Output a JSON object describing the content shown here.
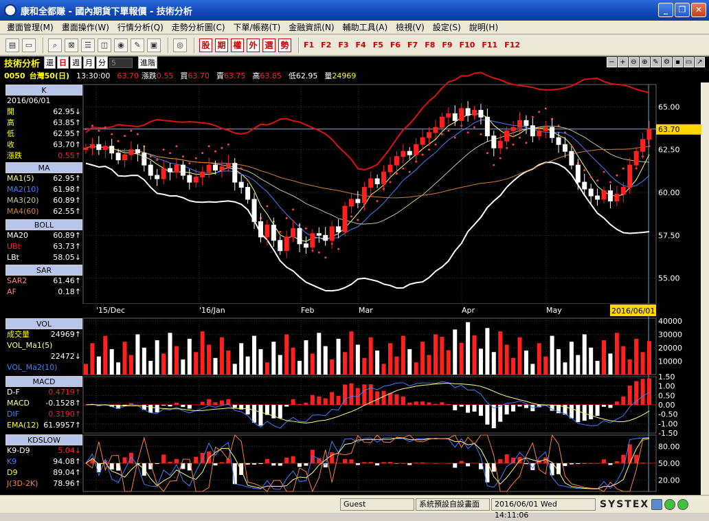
{
  "window": {
    "title": "康和全都賺 - 國內期貨下單報價 - 技術分析"
  },
  "menu": [
    "畫面管理(M)",
    "畫面操作(W)",
    "行情分析(Q)",
    "走勢分析圖(C)",
    "下單/帳務(T)",
    "金融資訊(N)",
    "輔助工具(A)",
    "檢視(V)",
    "設定(S)",
    "說明(H)"
  ],
  "quick_buttons": [
    "股",
    "期",
    "權",
    "外",
    "選",
    "勢"
  ],
  "fkeys": [
    "F1",
    "F2",
    "F3",
    "F4",
    "F5",
    "F6",
    "F7",
    "F8",
    "F9",
    "F10",
    "F11",
    "F12"
  ],
  "module": {
    "title": "技術分析",
    "btn_return": "還",
    "btn_day": "日",
    "btn_week": "週",
    "btn_month": "月",
    "btn_min": "分",
    "period_value": "5",
    "advanced": "進階"
  },
  "quote": {
    "code": "0050",
    "name": "台灣50(日)",
    "time": "13:30:00",
    "price": "63.70",
    "change_label": "漲跌",
    "change": "0.55",
    "bid_label": "買",
    "bid": "63.70",
    "ask_label": "賣",
    "ask": "63.75",
    "high_label": "高",
    "high": "63.85",
    "low_label": "低",
    "low": "62.95",
    "vol_label": "量",
    "vol": "24969"
  },
  "k_panel": {
    "header": "K",
    "date": "2016/06/01",
    "rows": [
      {
        "label": "開",
        "value": "62.95↓"
      },
      {
        "label": "高",
        "value": "63.85↑"
      },
      {
        "label": "低",
        "value": "62.95↑"
      },
      {
        "label": "收",
        "value": "63.70↑"
      },
      {
        "label": "漲跌",
        "value": "0.55↑"
      }
    ]
  },
  "ma_panel": {
    "header": "MA",
    "rows": [
      {
        "label": "MA1(5)",
        "value": "62.95↑"
      },
      {
        "label": "MA2(10)",
        "value": "61.98↑"
      },
      {
        "label": "MA3(20)",
        "value": "60.89↑"
      },
      {
        "label": "MA4(60)",
        "value": "62.55↑"
      }
    ]
  },
  "boll_panel": {
    "header": "BOLL",
    "rows": [
      {
        "label": "MA20",
        "value": "60.89↑"
      },
      {
        "label": "UBt",
        "value": "63.73↑"
      },
      {
        "label": "LBt",
        "value": "58.05↓"
      }
    ]
  },
  "sar_panel": {
    "header": "SAR",
    "rows": [
      {
        "label": "SAR2",
        "value": "61.46↑"
      },
      {
        "label": "AF",
        "value": "0.18↑"
      }
    ]
  },
  "vol_panel": {
    "header": "VOL",
    "rows": [
      {
        "label": "成交量",
        "value": "24969↑"
      },
      {
        "label": "VOL_Ma1(5)",
        "value": ""
      },
      {
        "label": "",
        "value": "22472↓"
      },
      {
        "label": "VOL_Ma2(10)",
        "value": ""
      }
    ]
  },
  "macd_panel": {
    "header": "MACD",
    "rows": [
      {
        "label": "D-F",
        "value": "0.4719↑"
      },
      {
        "label": "MACD",
        "value": "-0.1528↑"
      },
      {
        "label": "DIF",
        "value": "0.3190↑"
      },
      {
        "label": "EMA(12)",
        "value": "61.9957↑"
      }
    ]
  },
  "kd_panel": {
    "header": "KDSLOW",
    "rows": [
      {
        "label": "K9-D9",
        "value": "5.04↓"
      },
      {
        "label": "K9",
        "value": "94.08↑"
      },
      {
        "label": "D9",
        "value": "89.04↑"
      },
      {
        "label": "J(3D-2K)",
        "value": "78.96↑"
      }
    ]
  },
  "price_axis": [
    "65.00",
    "62.50",
    "60.00",
    "57.50",
    "55.00"
  ],
  "last_price_tag": "63.70",
  "time_axis": [
    "'15/Dec",
    "'16/Jan",
    "Feb",
    "Mar",
    "Apr",
    "May"
  ],
  "cursor_date": "2016/06/01",
  "vol_axis": [
    "40000",
    "30000",
    "20000",
    "10000"
  ],
  "macd_axis": [
    "1.50",
    "1.00",
    "0.50",
    "0.00",
    "-0.50",
    "-1.00",
    "-1.50"
  ],
  "kd_axis": [
    "80.00",
    "50.00",
    "20.00"
  ],
  "colors": {
    "up": "#ff2020",
    "down": "#ffffff",
    "upper_band": "#e01010",
    "lower_band": "#ffffff",
    "ma5": "#ffff80",
    "ma10": "#4080ff",
    "ma20": "#c8c890",
    "ma60": "#d08030",
    "sar": "#ff4040"
  },
  "status": {
    "user": "Guest",
    "layout": "系統預設自設畫面",
    "datetime": "2016/06/01 Wed 14:11:06",
    "brand": "SYSTEX"
  },
  "chart_data": {
    "type": "candlestick",
    "title": "",
    "x_range": [
      "2015-11-24",
      "2016-06-01"
    ],
    "y_range": [
      53.5,
      66.3
    ],
    "closes": [
      62.6,
      62.8,
      62.5,
      62.7,
      62.3,
      61.9,
      62.2,
      62.5,
      62.3,
      61.6,
      61.0,
      60.8,
      61.4,
      61.2,
      61.6,
      61.0,
      60.6,
      60.9,
      61.2,
      61.6,
      61.3,
      61.5,
      61.7,
      60.6,
      60.3,
      59.6,
      58.3,
      57.4,
      58.1,
      57.2,
      56.6,
      57.4,
      57.9,
      57.0,
      56.8,
      57.6,
      57.5,
      57.2,
      58.0,
      57.7,
      59.2,
      59.6,
      59.4,
      60.3,
      60.8,
      60.5,
      61.2,
      61.6,
      62.1,
      62.4,
      62.2,
      62.8,
      63.2,
      63.5,
      63.8,
      64.4,
      64.6,
      64.2,
      64.9,
      64.5,
      64.8,
      64.4,
      63.3,
      62.6,
      63.0,
      63.6,
      63.8,
      64.2,
      63.9,
      63.3,
      63.6,
      63.8,
      63.2,
      62.8,
      62.4,
      61.6,
      60.6,
      60.2,
      59.8,
      59.6,
      60.1,
      59.5,
      59.9,
      60.3,
      61.6,
      62.4,
      63.1,
      63.7
    ],
    "volume_last": 24969,
    "vol_ma5_last": 22472
  }
}
